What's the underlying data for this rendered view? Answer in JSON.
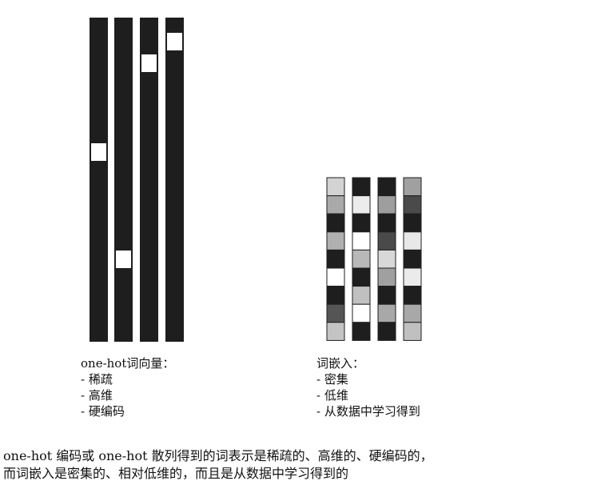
{
  "onehot": {
    "title": "one-hot词向量：",
    "items": [
      "稀疏",
      "高维",
      "硬编码"
    ],
    "hot_positions": [
      0.41,
      0.76,
      0.12,
      0.05
    ]
  },
  "embedding": {
    "title": "词嵌入：",
    "items": [
      "密集",
      "低维",
      "从数据中学习得到"
    ],
    "columns": [
      [
        "#d3d3d3",
        "#a9a9a9",
        "#1e1e1e",
        "#b0b0b0",
        "#1e1e1e",
        "#ffffff",
        "#1e1e1e",
        "#555555",
        "#c4c4c4"
      ],
      [
        "#1e1e1e",
        "#ececec",
        "#1e1e1e",
        "#ffffff",
        "#b9b9b9",
        "#1e1e1e",
        "#c0c0c0",
        "#ffffff",
        "#1e1e1e"
      ],
      [
        "#1e1e1e",
        "#9e9e9e",
        "#1e1e1e",
        "#4a4a4a",
        "#d8d8d8",
        "#a0a0a0",
        "#1e1e1e",
        "#a8a8a8",
        "#1e1e1e"
      ],
      [
        "#a0a0a0",
        "#4a4a4a",
        "#1e1e1e",
        "#e8e8e8",
        "#1e1e1e",
        "#ebebeb",
        "#1e1e1e",
        "#a8a8a8",
        "#c0c0c0"
      ]
    ]
  },
  "caption": {
    "line1": "one-hot 编码或 one-hot 散列得到的词表示是稀疏的、高维的、硬编码的，",
    "line2": "而词嵌入是密集的、相对低维的，而且是从数据中学习得到的"
  },
  "colors": {
    "bar": "#1e1e1e",
    "hot": "#ffffff"
  }
}
